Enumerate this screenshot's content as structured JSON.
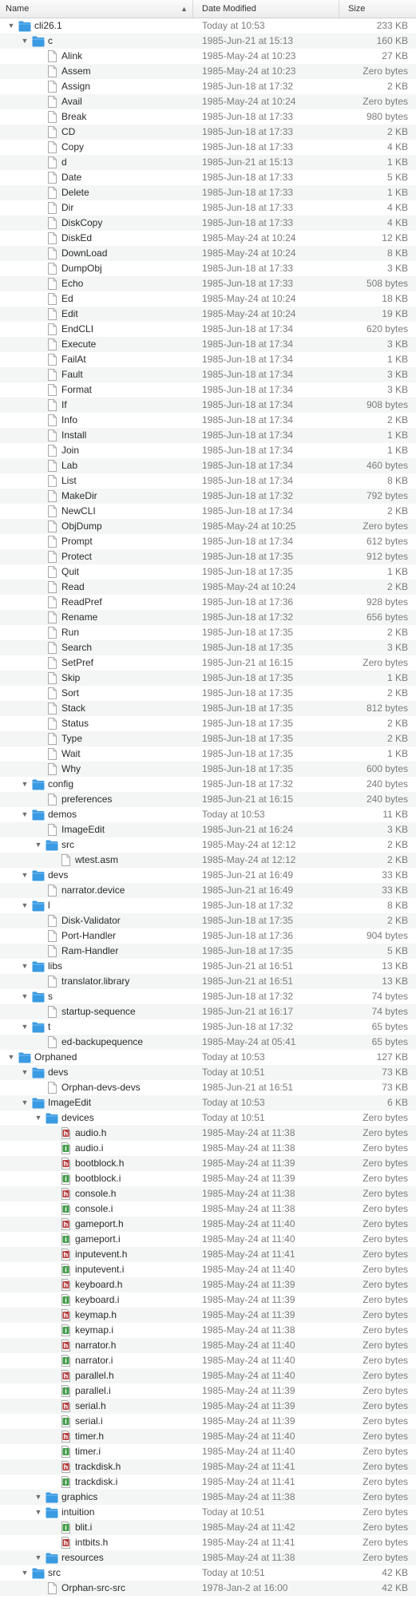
{
  "header": {
    "name": "Name",
    "date": "Date Modified",
    "size": "Size"
  },
  "colors": {
    "folder": "#3a9ae2",
    "h_file": "#b53a3a",
    "i_file": "#3f9b46"
  },
  "rows": [
    {
      "d": 0,
      "t": "folder",
      "o": true,
      "n": "cli26.1",
      "m": "Today at 10:53",
      "s": "233 KB"
    },
    {
      "d": 1,
      "t": "folder",
      "o": true,
      "n": "c",
      "m": "1985-Jun-21 at 15:13",
      "s": "160 KB"
    },
    {
      "d": 2,
      "t": "file",
      "n": "Alink",
      "m": "1985-May-24 at 10:23",
      "s": "27 KB"
    },
    {
      "d": 2,
      "t": "file",
      "n": "Assem",
      "m": "1985-May-24 at 10:23",
      "s": "Zero bytes"
    },
    {
      "d": 2,
      "t": "file",
      "n": "Assign",
      "m": "1985-Jun-18 at 17:32",
      "s": "2 KB"
    },
    {
      "d": 2,
      "t": "file",
      "n": "Avail",
      "m": "1985-May-24 at 10:24",
      "s": "Zero bytes"
    },
    {
      "d": 2,
      "t": "file",
      "n": "Break",
      "m": "1985-Jun-18 at 17:33",
      "s": "980 bytes"
    },
    {
      "d": 2,
      "t": "file",
      "n": "CD",
      "m": "1985-Jun-18 at 17:33",
      "s": "2 KB"
    },
    {
      "d": 2,
      "t": "file",
      "n": "Copy",
      "m": "1985-Jun-18 at 17:33",
      "s": "4 KB"
    },
    {
      "d": 2,
      "t": "file",
      "n": "d",
      "m": "1985-Jun-21 at 15:13",
      "s": "1 KB"
    },
    {
      "d": 2,
      "t": "file",
      "n": "Date",
      "m": "1985-Jun-18 at 17:33",
      "s": "5 KB"
    },
    {
      "d": 2,
      "t": "file",
      "n": "Delete",
      "m": "1985-Jun-18 at 17:33",
      "s": "1 KB"
    },
    {
      "d": 2,
      "t": "file",
      "n": "Dir",
      "m": "1985-Jun-18 at 17:33",
      "s": "4 KB"
    },
    {
      "d": 2,
      "t": "file",
      "n": "DiskCopy",
      "m": "1985-Jun-18 at 17:33",
      "s": "4 KB"
    },
    {
      "d": 2,
      "t": "file",
      "n": "DiskEd",
      "m": "1985-May-24 at 10:24",
      "s": "12 KB"
    },
    {
      "d": 2,
      "t": "file",
      "n": "DownLoad",
      "m": "1985-May-24 at 10:24",
      "s": "8 KB"
    },
    {
      "d": 2,
      "t": "file",
      "n": "DumpObj",
      "m": "1985-Jun-18 at 17:33",
      "s": "3 KB"
    },
    {
      "d": 2,
      "t": "file",
      "n": "Echo",
      "m": "1985-Jun-18 at 17:33",
      "s": "508 bytes"
    },
    {
      "d": 2,
      "t": "file",
      "n": "Ed",
      "m": "1985-May-24 at 10:24",
      "s": "18 KB"
    },
    {
      "d": 2,
      "t": "file",
      "n": "Edit",
      "m": "1985-May-24 at 10:24",
      "s": "19 KB"
    },
    {
      "d": 2,
      "t": "file",
      "n": "EndCLI",
      "m": "1985-Jun-18 at 17:34",
      "s": "620 bytes"
    },
    {
      "d": 2,
      "t": "file",
      "n": "Execute",
      "m": "1985-Jun-18 at 17:34",
      "s": "3 KB"
    },
    {
      "d": 2,
      "t": "file",
      "n": "FailAt",
      "m": "1985-Jun-18 at 17:34",
      "s": "1 KB"
    },
    {
      "d": 2,
      "t": "file",
      "n": "Fault",
      "m": "1985-Jun-18 at 17:34",
      "s": "3 KB"
    },
    {
      "d": 2,
      "t": "file",
      "n": "Format",
      "m": "1985-Jun-18 at 17:34",
      "s": "3 KB"
    },
    {
      "d": 2,
      "t": "file",
      "n": "If",
      "m": "1985-Jun-18 at 17:34",
      "s": "908 bytes"
    },
    {
      "d": 2,
      "t": "file",
      "n": "Info",
      "m": "1985-Jun-18 at 17:34",
      "s": "2 KB"
    },
    {
      "d": 2,
      "t": "file",
      "n": "Install",
      "m": "1985-Jun-18 at 17:34",
      "s": "1 KB"
    },
    {
      "d": 2,
      "t": "file",
      "n": "Join",
      "m": "1985-Jun-18 at 17:34",
      "s": "1 KB"
    },
    {
      "d": 2,
      "t": "file",
      "n": "Lab",
      "m": "1985-Jun-18 at 17:34",
      "s": "460 bytes"
    },
    {
      "d": 2,
      "t": "file",
      "n": "List",
      "m": "1985-Jun-18 at 17:34",
      "s": "8 KB"
    },
    {
      "d": 2,
      "t": "file",
      "n": "MakeDir",
      "m": "1985-Jun-18 at 17:32",
      "s": "792 bytes"
    },
    {
      "d": 2,
      "t": "file",
      "n": "NewCLI",
      "m": "1985-Jun-18 at 17:34",
      "s": "2 KB"
    },
    {
      "d": 2,
      "t": "file",
      "n": "ObjDump",
      "m": "1985-May-24 at 10:25",
      "s": "Zero bytes"
    },
    {
      "d": 2,
      "t": "file",
      "n": "Prompt",
      "m": "1985-Jun-18 at 17:34",
      "s": "612 bytes"
    },
    {
      "d": 2,
      "t": "file",
      "n": "Protect",
      "m": "1985-Jun-18 at 17:35",
      "s": "912 bytes"
    },
    {
      "d": 2,
      "t": "file",
      "n": "Quit",
      "m": "1985-Jun-18 at 17:35",
      "s": "1 KB"
    },
    {
      "d": 2,
      "t": "file",
      "n": "Read",
      "m": "1985-May-24 at 10:24",
      "s": "2 KB"
    },
    {
      "d": 2,
      "t": "file",
      "n": "ReadPref",
      "m": "1985-Jun-18 at 17:36",
      "s": "928 bytes"
    },
    {
      "d": 2,
      "t": "file",
      "n": "Rename",
      "m": "1985-Jun-18 at 17:32",
      "s": "656 bytes"
    },
    {
      "d": 2,
      "t": "file",
      "n": "Run",
      "m": "1985-Jun-18 at 17:35",
      "s": "2 KB"
    },
    {
      "d": 2,
      "t": "file",
      "n": "Search",
      "m": "1985-Jun-18 at 17:35",
      "s": "3 KB"
    },
    {
      "d": 2,
      "t": "file",
      "n": "SetPref",
      "m": "1985-Jun-21 at 16:15",
      "s": "Zero bytes"
    },
    {
      "d": 2,
      "t": "file",
      "n": "Skip",
      "m": "1985-Jun-18 at 17:35",
      "s": "1 KB"
    },
    {
      "d": 2,
      "t": "file",
      "n": "Sort",
      "m": "1985-Jun-18 at 17:35",
      "s": "2 KB"
    },
    {
      "d": 2,
      "t": "file",
      "n": "Stack",
      "m": "1985-Jun-18 at 17:35",
      "s": "812 bytes"
    },
    {
      "d": 2,
      "t": "file",
      "n": "Status",
      "m": "1985-Jun-18 at 17:35",
      "s": "2 KB"
    },
    {
      "d": 2,
      "t": "file",
      "n": "Type",
      "m": "1985-Jun-18 at 17:35",
      "s": "2 KB"
    },
    {
      "d": 2,
      "t": "file",
      "n": "Wait",
      "m": "1985-Jun-18 at 17:35",
      "s": "1 KB"
    },
    {
      "d": 2,
      "t": "file",
      "n": "Why",
      "m": "1985-Jun-18 at 17:35",
      "s": "600 bytes"
    },
    {
      "d": 1,
      "t": "folder",
      "o": true,
      "n": "config",
      "m": "1985-Jun-18 at 17:32",
      "s": "240 bytes"
    },
    {
      "d": 2,
      "t": "file",
      "n": "preferences",
      "m": "1985-Jun-21 at 16:15",
      "s": "240 bytes"
    },
    {
      "d": 1,
      "t": "folder",
      "o": true,
      "n": "demos",
      "m": "Today at 10:53",
      "s": "11 KB"
    },
    {
      "d": 2,
      "t": "file",
      "n": "ImageEdit",
      "m": "1985-Jun-21 at 16:24",
      "s": "3 KB"
    },
    {
      "d": 2,
      "t": "folder",
      "o": true,
      "n": "src",
      "m": "1985-May-24 at 12:12",
      "s": "2 KB"
    },
    {
      "d": 3,
      "t": "file",
      "n": "wtest.asm",
      "m": "1985-May-24 at 12:12",
      "s": "2 KB"
    },
    {
      "d": 1,
      "t": "folder",
      "o": true,
      "n": "devs",
      "m": "1985-Jun-21 at 16:49",
      "s": "33 KB"
    },
    {
      "d": 2,
      "t": "file",
      "n": "narrator.device",
      "m": "1985-Jun-21 at 16:49",
      "s": "33 KB"
    },
    {
      "d": 1,
      "t": "folder",
      "o": true,
      "n": "l",
      "m": "1985-Jun-18 at 17:32",
      "s": "8 KB"
    },
    {
      "d": 2,
      "t": "file",
      "n": "Disk-Validator",
      "m": "1985-Jun-18 at 17:35",
      "s": "2 KB"
    },
    {
      "d": 2,
      "t": "file",
      "n": "Port-Handler",
      "m": "1985-Jun-18 at 17:36",
      "s": "904 bytes"
    },
    {
      "d": 2,
      "t": "file",
      "n": "Ram-Handler",
      "m": "1985-Jun-18 at 17:35",
      "s": "5 KB"
    },
    {
      "d": 1,
      "t": "folder",
      "o": true,
      "n": "libs",
      "m": "1985-Jun-21 at 16:51",
      "s": "13 KB"
    },
    {
      "d": 2,
      "t": "file",
      "n": "translator.library",
      "m": "1985-Jun-21 at 16:51",
      "s": "13 KB"
    },
    {
      "d": 1,
      "t": "folder",
      "o": true,
      "n": "s",
      "m": "1985-Jun-18 at 17:32",
      "s": "74 bytes"
    },
    {
      "d": 2,
      "t": "file",
      "n": "startup-sequence",
      "m": "1985-Jun-21 at 16:17",
      "s": "74 bytes"
    },
    {
      "d": 1,
      "t": "folder",
      "o": true,
      "n": "t",
      "m": "1985-Jun-18 at 17:32",
      "s": "65 bytes"
    },
    {
      "d": 2,
      "t": "file",
      "n": "ed-backupequence",
      "m": "1985-May-24 at 05:41",
      "s": "65 bytes"
    },
    {
      "d": 0,
      "t": "folder",
      "o": true,
      "n": "Orphaned",
      "m": "Today at 10:53",
      "s": "127 KB"
    },
    {
      "d": 1,
      "t": "folder",
      "o": true,
      "n": "devs",
      "m": "Today at 10:51",
      "s": "73 KB"
    },
    {
      "d": 2,
      "t": "file",
      "n": "Orphan-devs-devs",
      "m": "1985-Jun-21 at 16:51",
      "s": "73 KB"
    },
    {
      "d": 1,
      "t": "folder",
      "o": true,
      "n": "ImageEdit",
      "m": "Today at 10:53",
      "s": "6 KB"
    },
    {
      "d": 2,
      "t": "folder",
      "o": true,
      "n": "devices",
      "m": "Today at 10:51",
      "s": "Zero bytes"
    },
    {
      "d": 3,
      "t": "h",
      "n": "audio.h",
      "m": "1985-May-24 at 11:38",
      "s": "Zero bytes"
    },
    {
      "d": 3,
      "t": "i",
      "n": "audio.i",
      "m": "1985-May-24 at 11:38",
      "s": "Zero bytes"
    },
    {
      "d": 3,
      "t": "h",
      "n": "bootblock.h",
      "m": "1985-May-24 at 11:39",
      "s": "Zero bytes"
    },
    {
      "d": 3,
      "t": "i",
      "n": "bootblock.i",
      "m": "1985-May-24 at 11:39",
      "s": "Zero bytes"
    },
    {
      "d": 3,
      "t": "h",
      "n": "console.h",
      "m": "1985-May-24 at 11:38",
      "s": "Zero bytes"
    },
    {
      "d": 3,
      "t": "i",
      "n": "console.i",
      "m": "1985-May-24 at 11:38",
      "s": "Zero bytes"
    },
    {
      "d": 3,
      "t": "h",
      "n": "gameport.h",
      "m": "1985-May-24 at 11:40",
      "s": "Zero bytes"
    },
    {
      "d": 3,
      "t": "i",
      "n": "gameport.i",
      "m": "1985-May-24 at 11:40",
      "s": "Zero bytes"
    },
    {
      "d": 3,
      "t": "h",
      "n": "inputevent.h",
      "m": "1985-May-24 at 11:41",
      "s": "Zero bytes"
    },
    {
      "d": 3,
      "t": "i",
      "n": "inputevent.i",
      "m": "1985-May-24 at 11:40",
      "s": "Zero bytes"
    },
    {
      "d": 3,
      "t": "h",
      "n": "keyboard.h",
      "m": "1985-May-24 at 11:39",
      "s": "Zero bytes"
    },
    {
      "d": 3,
      "t": "i",
      "n": "keyboard.i",
      "m": "1985-May-24 at 11:39",
      "s": "Zero bytes"
    },
    {
      "d": 3,
      "t": "h",
      "n": "keymap.h",
      "m": "1985-May-24 at 11:39",
      "s": "Zero bytes"
    },
    {
      "d": 3,
      "t": "i",
      "n": "keymap.i",
      "m": "1985-May-24 at 11:38",
      "s": "Zero bytes"
    },
    {
      "d": 3,
      "t": "h",
      "n": "narrator.h",
      "m": "1985-May-24 at 11:40",
      "s": "Zero bytes"
    },
    {
      "d": 3,
      "t": "i",
      "n": "narrator.i",
      "m": "1985-May-24 at 11:40",
      "s": "Zero bytes"
    },
    {
      "d": 3,
      "t": "h",
      "n": "parallel.h",
      "m": "1985-May-24 at 11:40",
      "s": "Zero bytes"
    },
    {
      "d": 3,
      "t": "i",
      "n": "parallel.i",
      "m": "1985-May-24 at 11:39",
      "s": "Zero bytes"
    },
    {
      "d": 3,
      "t": "h",
      "n": "serial.h",
      "m": "1985-May-24 at 11:39",
      "s": "Zero bytes"
    },
    {
      "d": 3,
      "t": "i",
      "n": "serial.i",
      "m": "1985-May-24 at 11:39",
      "s": "Zero bytes"
    },
    {
      "d": 3,
      "t": "h",
      "n": "timer.h",
      "m": "1985-May-24 at 11:40",
      "s": "Zero bytes"
    },
    {
      "d": 3,
      "t": "i",
      "n": "timer.i",
      "m": "1985-May-24 at 11:40",
      "s": "Zero bytes"
    },
    {
      "d": 3,
      "t": "h",
      "n": "trackdisk.h",
      "m": "1985-May-24 at 11:41",
      "s": "Zero bytes"
    },
    {
      "d": 3,
      "t": "i",
      "n": "trackdisk.i",
      "m": "1985-May-24 at 11:41",
      "s": "Zero bytes"
    },
    {
      "d": 2,
      "t": "folder",
      "o": true,
      "n": "graphics",
      "m": "1985-May-24 at 11:38",
      "s": "Zero bytes"
    },
    {
      "d": 2,
      "t": "folder",
      "o": true,
      "n": "intuition",
      "m": "Today at 10:51",
      "s": "Zero bytes"
    },
    {
      "d": 3,
      "t": "i",
      "n": "blit.i",
      "m": "1985-May-24 at 11:42",
      "s": "Zero bytes"
    },
    {
      "d": 3,
      "t": "h",
      "n": "intbits.h",
      "m": "1985-May-24 at 11:41",
      "s": "Zero bytes"
    },
    {
      "d": 2,
      "t": "folder",
      "o": true,
      "n": "resources",
      "m": "1985-May-24 at 11:38",
      "s": "Zero bytes"
    },
    {
      "d": 1,
      "t": "folder",
      "o": true,
      "n": "src",
      "m": "Today at 10:51",
      "s": "42 KB"
    },
    {
      "d": 2,
      "t": "file",
      "n": "Orphan-src-src",
      "m": "1978-Jan-2 at 16:00",
      "s": "42 KB"
    }
  ]
}
